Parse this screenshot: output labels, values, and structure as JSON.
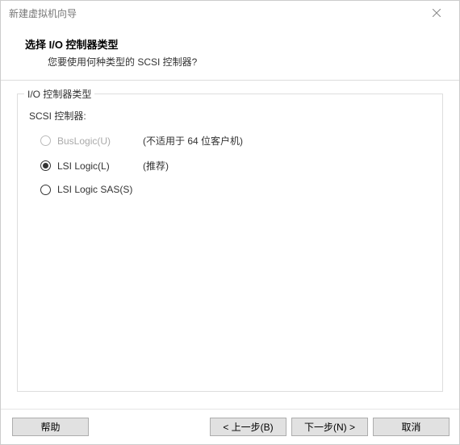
{
  "window": {
    "title": "新建虚拟机向导"
  },
  "header": {
    "title": "选择 I/O 控制器类型",
    "subtitle": "您要使用何种类型的 SCSI 控制器?"
  },
  "group": {
    "legend": "I/O 控制器类型",
    "sublabel": "SCSI 控制器:"
  },
  "options": {
    "buslogic": {
      "label": "BusLogic(U)",
      "hint": "(不适用于 64 位客户机)"
    },
    "lsilogic": {
      "label": "LSI Logic(L)",
      "hint": "(推荐)"
    },
    "lsilogicsas": {
      "label": "LSI Logic SAS(S)",
      "hint": ""
    }
  },
  "footer": {
    "help": "帮助",
    "back": "< 上一步(B)",
    "next": "下一步(N) >",
    "cancel": "取消"
  }
}
